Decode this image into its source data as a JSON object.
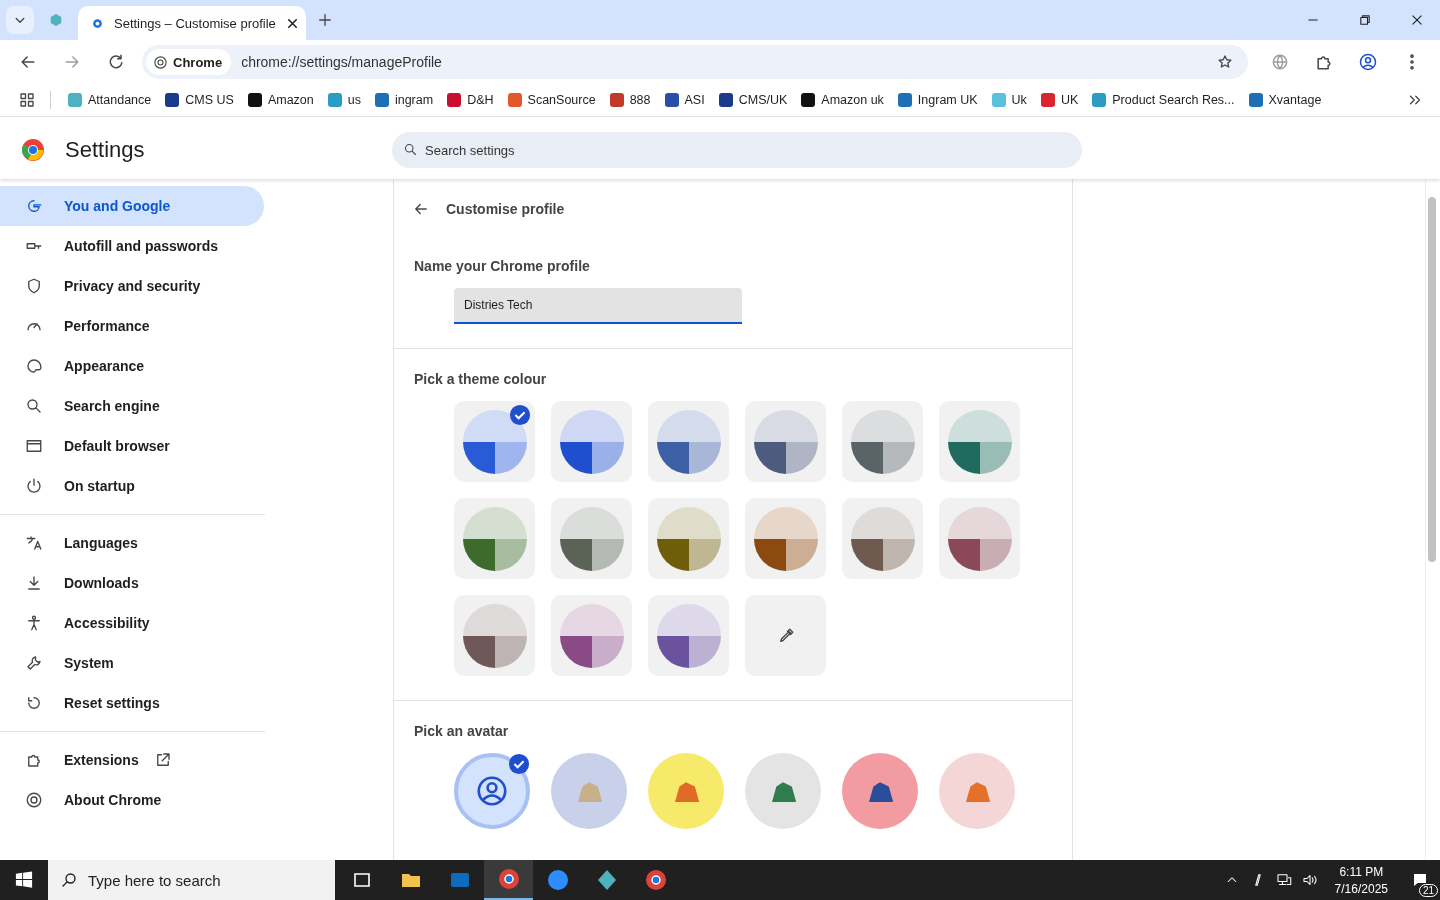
{
  "browser": {
    "tab": {
      "title": "Settings – Customise profile",
      "selected": true
    },
    "address": {
      "chip": "Chrome",
      "url": "chrome://settings/manageProfile"
    },
    "bookmarks": [
      {
        "label": "Attandance",
        "color": "#4fb3bf"
      },
      {
        "label": "CMS US",
        "color": "#1a3a8c"
      },
      {
        "label": "Amazon",
        "color": "#111111"
      },
      {
        "label": "us",
        "color": "#2a9dc4"
      },
      {
        "label": "ingram",
        "color": "#1f6fb5"
      },
      {
        "label": "D&H",
        "color": "#c8102e"
      },
      {
        "label": "ScanSource",
        "color": "#e4572e"
      },
      {
        "label": "888",
        "color": "#c0392b"
      },
      {
        "label": "ASI",
        "color": "#2b4fa8"
      },
      {
        "label": "CMS/UK",
        "color": "#1a3a8c"
      },
      {
        "label": "Amazon uk",
        "color": "#111111"
      },
      {
        "label": "Ingram UK",
        "color": "#1f6fb5"
      },
      {
        "label": "Uk",
        "color": "#5bc0de"
      },
      {
        "label": "UK",
        "color": "#d9262e"
      },
      {
        "label": "Product Search Res...",
        "color": "#2a9dc4"
      },
      {
        "label": "Xvantage",
        "color": "#1f6fb5"
      }
    ]
  },
  "settings": {
    "title": "Settings",
    "search": {
      "placeholder": "Search settings"
    }
  },
  "sidebar": {
    "groups": [
      {
        "items": [
          {
            "label": "You and Google",
            "kind": "google",
            "selected": true,
            "external": false
          },
          {
            "label": "Autofill and passwords",
            "kind": "key",
            "selected": false,
            "external": false
          },
          {
            "label": "Privacy and security",
            "kind": "shield",
            "selected": false,
            "external": false
          },
          {
            "label": "Performance",
            "kind": "gauge",
            "selected": false,
            "external": false
          },
          {
            "label": "Appearance",
            "kind": "palette",
            "selected": false,
            "external": false
          },
          {
            "label": "Search engine",
            "kind": "search",
            "selected": false,
            "external": false
          },
          {
            "label": "Default browser",
            "kind": "window",
            "selected": false,
            "external": false
          },
          {
            "label": "On startup",
            "kind": "power",
            "selected": false,
            "external": false
          }
        ]
      },
      {
        "items": [
          {
            "label": "Languages",
            "kind": "translate",
            "selected": false,
            "external": false
          },
          {
            "label": "Downloads",
            "kind": "download",
            "selected": false,
            "external": false
          },
          {
            "label": "Accessibility",
            "kind": "person",
            "selected": false,
            "external": false
          },
          {
            "label": "System",
            "kind": "wrench",
            "selected": false,
            "external": false
          },
          {
            "label": "Reset settings",
            "kind": "reset",
            "selected": false,
            "external": false
          }
        ]
      },
      {
        "items": [
          {
            "label": "Extensions",
            "kind": "puzzle",
            "selected": false,
            "external": true
          },
          {
            "label": "About Chrome",
            "kind": "chrome",
            "selected": false,
            "external": false
          }
        ]
      }
    ]
  },
  "page": {
    "title": "Customise profile",
    "name_label": "Name your Chrome profile",
    "name_value": "Distries Tech",
    "theme_label": "Pick a theme colour",
    "themes": [
      {
        "kind": "color",
        "color": "#2a5bd7",
        "selected": true
      },
      {
        "kind": "color",
        "color": "#1f4fcc",
        "selected": false
      },
      {
        "kind": "color",
        "color": "#3d5fa6",
        "selected": false
      },
      {
        "kind": "color",
        "color": "#4d5b7e",
        "selected": false
      },
      {
        "kind": "color",
        "color": "#5a6467",
        "selected": false
      },
      {
        "kind": "color",
        "color": "#1f6b5e",
        "selected": false
      },
      {
        "kind": "color",
        "color": "#3d6b2c",
        "selected": false
      },
      {
        "kind": "color",
        "color": "#5a6356",
        "selected": false
      },
      {
        "kind": "color",
        "color": "#6e5e0a",
        "selected": false
      },
      {
        "kind": "color",
        "color": "#8c4a10",
        "selected": false
      },
      {
        "kind": "color",
        "color": "#6e5a4e",
        "selected": false
      },
      {
        "kind": "color",
        "color": "#8a4858",
        "selected": false
      },
      {
        "kind": "color",
        "color": "#6e5858",
        "selected": false
      },
      {
        "kind": "color",
        "color": "#8a4a86",
        "selected": false
      },
      {
        "kind": "color",
        "color": "#6a529e",
        "selected": false
      },
      {
        "kind": "custom",
        "selected": false
      }
    ],
    "avatar_label": "Pick an avatar",
    "avatars": [
      {
        "kind": "person",
        "selected": true
      },
      {
        "kind": "cat",
        "selected": false
      },
      {
        "kind": "dog",
        "selected": false
      },
      {
        "kind": "dragon",
        "selected": false
      },
      {
        "kind": "elephant",
        "selected": false
      },
      {
        "kind": "fox",
        "selected": false
      }
    ]
  },
  "taskbar": {
    "search": {
      "placeholder": "Type here to search"
    },
    "apps": [
      {
        "kind": "taskview",
        "selected": false
      },
      {
        "kind": "folder",
        "selected": false
      },
      {
        "kind": "mail",
        "selected": false
      },
      {
        "kind": "chrome",
        "selected": true
      },
      {
        "kind": "zoom",
        "selected": false
      },
      {
        "kind": "gem",
        "selected": false
      },
      {
        "kind": "chrome",
        "selected": false
      }
    ],
    "time": "6:11 PM",
    "date": "7/16/2025",
    "notifications": "21"
  }
}
